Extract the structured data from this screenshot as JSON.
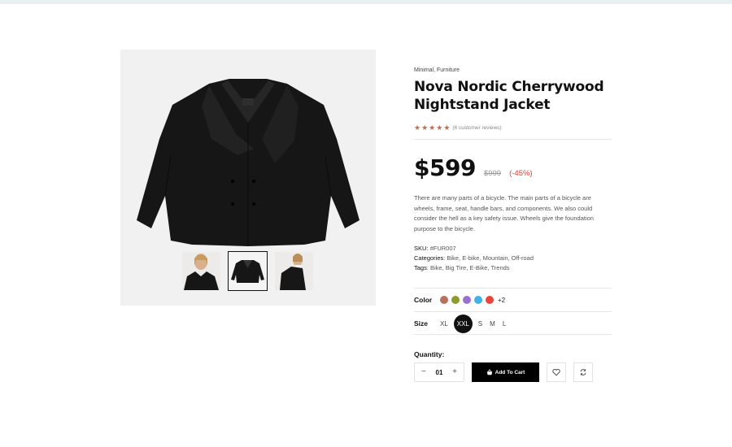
{
  "product": {
    "categories": "Minimal, Furniture",
    "title_line1": "Nova Nordic Cherrywood",
    "title_line2": "Nightstand Jacket",
    "rating": 5,
    "reviews": "(6 customer reviews)",
    "price": "$599",
    "old_price": "$999",
    "discount": "(-45%)",
    "description": "There are many parts of a bicycle. The main parts of a bicycle are wheels, frame, seat, handle bars, and components. We also could consider the hell as a key safety issue. Wheels give the foundation purpose to the bicycle.",
    "sku_label": "SKU:",
    "sku": " #FUR007",
    "categories_label": "Categories",
    "categories_value": ": Bike, E-bike, Mountain, Off-road",
    "tags_label": "Tags",
    "tags_value": ": Bike, Big Tire, E-Bike, Trends"
  },
  "color": {
    "label": "Color",
    "swatches": [
      "#b9705a",
      "#8d9b2a",
      "#9b6fd0",
      "#3fb3e6",
      "#e8453c"
    ],
    "more": "+2"
  },
  "size": {
    "label": "Size",
    "options": [
      "XL",
      "XXL",
      "S",
      "M",
      "L"
    ],
    "selected": "XXL"
  },
  "quantity": {
    "label": "Quantity:",
    "value": "01",
    "minus": "−",
    "plus": "+"
  },
  "buttons": {
    "add_to_cart": "Add To Cart"
  },
  "icons": {
    "cart": "basket-icon",
    "wishlist": "heart-icon",
    "compare": "refresh-icon",
    "star": "star-icon"
  }
}
